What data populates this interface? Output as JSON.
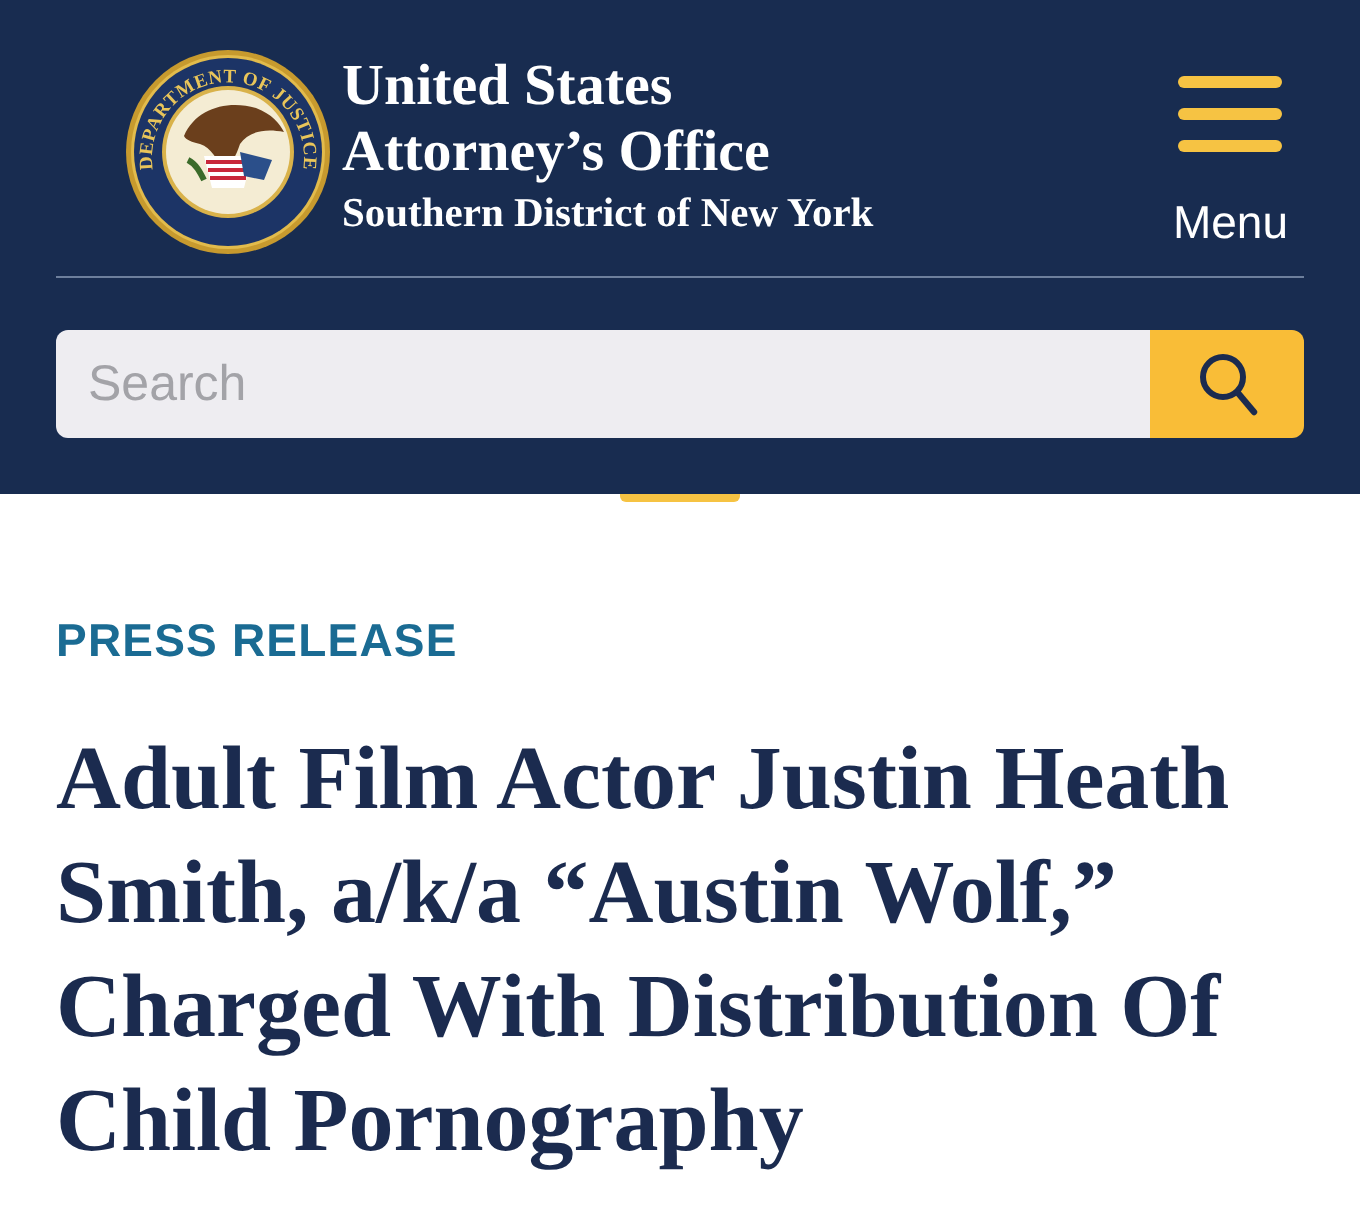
{
  "header": {
    "seal_text": "DEPARTMENT OF JUSTICE",
    "title_lines": [
      "United States",
      "Attorney’s Office"
    ],
    "subtitle": "Southern District of New York",
    "menu": {
      "label": "Menu"
    }
  },
  "search": {
    "placeholder": "Search"
  },
  "article": {
    "category": "PRESS RELEASE",
    "headline_lines": [
      "Adult Film Actor Justin Heath",
      "Smith, a/k/a “Austin Wolf,”",
      "Charged With Distribution Of",
      "Child Pornography"
    ]
  }
}
